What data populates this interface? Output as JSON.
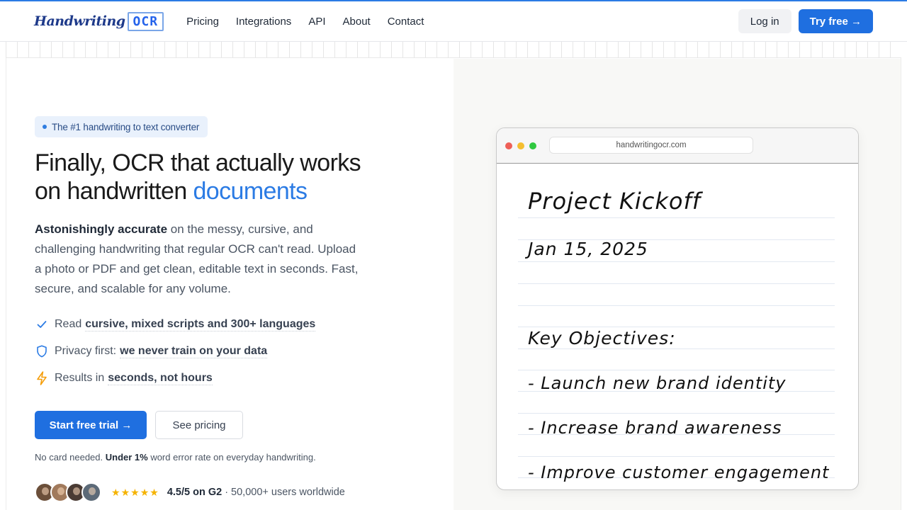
{
  "nav": {
    "logo_script": "Handwriting",
    "logo_mark": "OCR",
    "links": [
      "Pricing",
      "Integrations",
      "API",
      "About",
      "Contact"
    ],
    "login": "Log in",
    "try_free": "Try free →"
  },
  "hero": {
    "badge": "The #1 handwriting to text converter",
    "headline_line1": "Finally, OCR that actually works",
    "headline_line2_prefix": "on handwritten ",
    "headline_accent": "documents",
    "desc_strong": "Astonishingly accurate",
    "desc_rest": " on the messy, cursive, and challenging handwriting that regular OCR can't read. Upload a photo or PDF and get clean, editable text in seconds. Fast, secure, and scalable for any volume.",
    "features": [
      {
        "icon": "check-icon",
        "prefix": "Read",
        "emphasis": "cursive, mixed scripts and 300+ languages"
      },
      {
        "icon": "shield-icon",
        "prefix": "Privacy first:",
        "emphasis": "we never train on your data"
      },
      {
        "icon": "lightning-icon",
        "prefix": "Results in",
        "emphasis": "seconds, not hours"
      }
    ],
    "cta_primary": "Start free trial →",
    "cta_secondary": "See pricing",
    "fine_print_prefix": "No card needed. ",
    "fine_print_strong": "Under 1%",
    "fine_print_rest": " word error rate on everyday handwriting.",
    "rating": "4.5/5 on G2",
    "users": "· 50,000+ users worldwide"
  },
  "mockup": {
    "url": "handwritingocr.com",
    "note_title": "Project Kickoff",
    "note_date": "Jan 15, 2025",
    "note_heading": "Key Objectives:",
    "note_items": [
      "- Launch new brand identity",
      "- Increase brand awareness",
      "- Improve customer engagement"
    ]
  },
  "colors": {
    "accent": "#2b7be4",
    "primary_button": "#1f6fe0",
    "star": "#f5b301"
  }
}
